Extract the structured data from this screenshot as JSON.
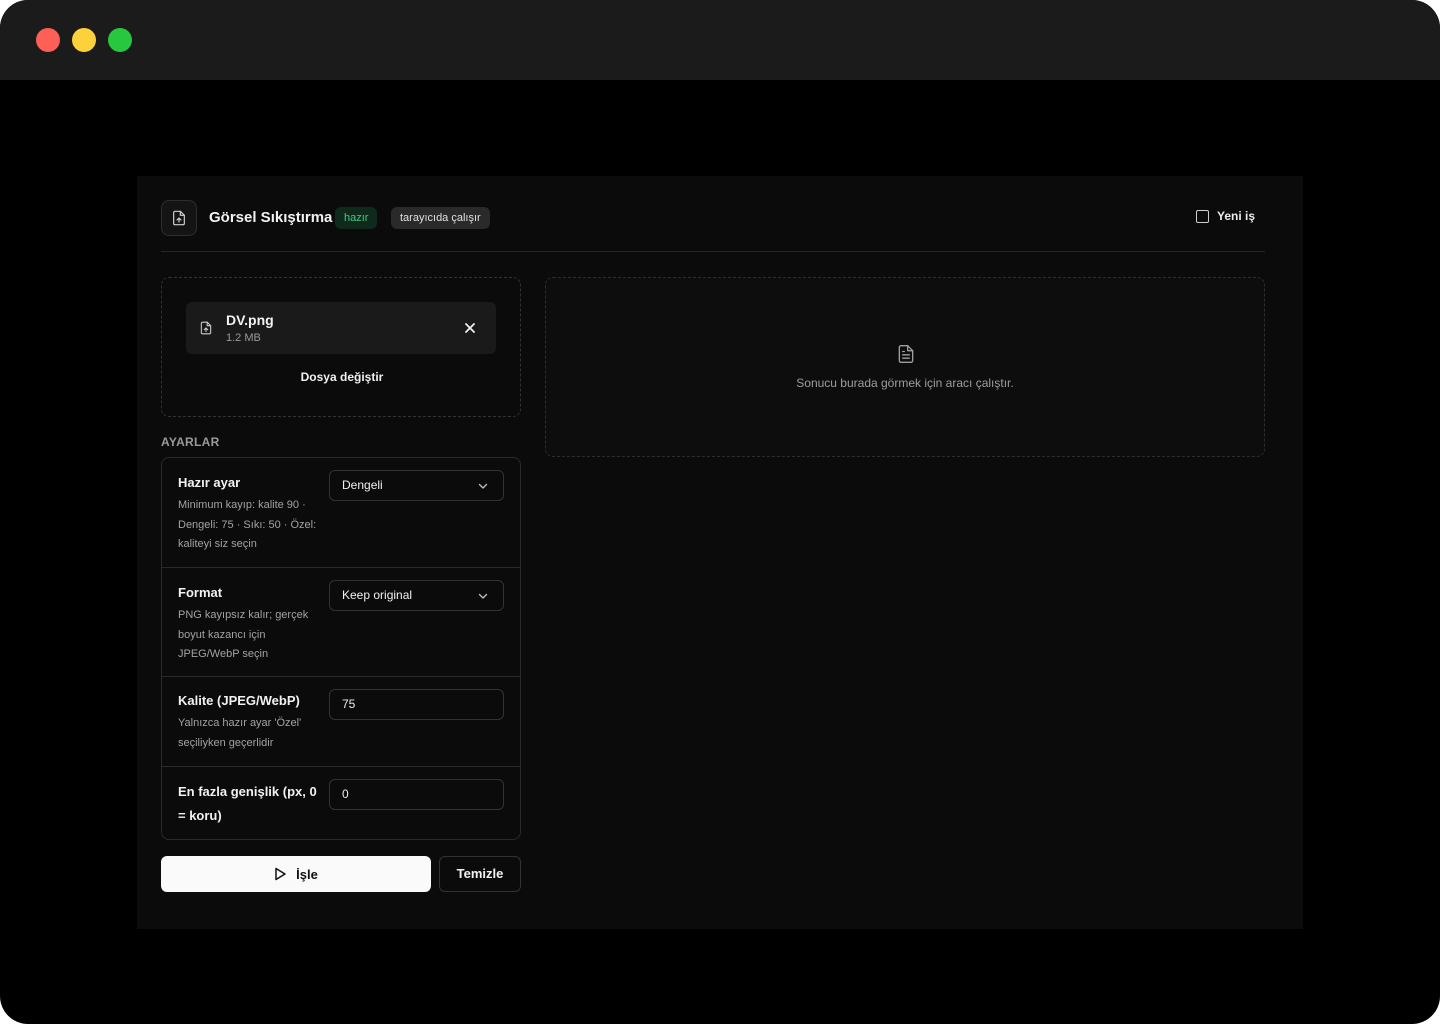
{
  "header": {
    "title": "Görsel Sıkıştırma",
    "status_badge": "hazır",
    "env_badge": "tarayıcıda çalışır",
    "new_job_label": "Yeni iş"
  },
  "file": {
    "name": "DV.png",
    "size": "1.2 MB",
    "change_label": "Dosya değiştir"
  },
  "settings": {
    "section_title": "AYARLAR",
    "preset": {
      "label": "Hazır ayar",
      "help": "Minimum kayıp: kalite 90 · Dengeli: 75 · Sıkı: 50 · Özel: kaliteyi siz seçin",
      "value": "Dengeli"
    },
    "format": {
      "label": "Format",
      "help": "PNG kayıpsız kalır; gerçek boyut kazancı için JPEG/WebP seçin",
      "value": "Keep original"
    },
    "quality": {
      "label": "Kalite (JPEG/WebP)",
      "help": "Yalnızca hazır ayar 'Özel' seçiliyken geçerlidir",
      "value": "75"
    },
    "max_width": {
      "label": "En fazla genişlik (px, 0 = koru)",
      "value": "0"
    }
  },
  "actions": {
    "run_label": "İşle",
    "clear_label": "Temizle"
  },
  "result": {
    "placeholder": "Sonucu burada görmek için aracı çalıştır."
  },
  "colors": {
    "ready_badge_text": "#3ecf82",
    "ready_badge_bg": "#0f2a1c",
    "window_red": "#fe5f57",
    "window_yellow": "#fdd13c",
    "window_green": "#27c840"
  },
  "icons": {
    "app": "file-upload-icon",
    "file": "file-upload-icon",
    "close": "close-icon",
    "chevron": "chevron-down-icon",
    "play": "play-icon",
    "result": "document-icon",
    "checkbox": "checkbox-icon"
  }
}
